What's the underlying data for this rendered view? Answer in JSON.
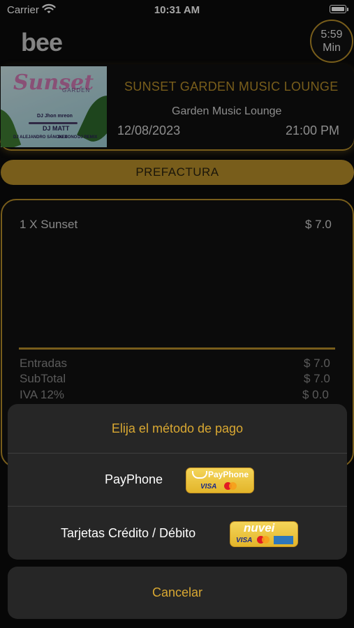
{
  "status_bar": {
    "carrier": "Carrier",
    "time": "10:31 AM"
  },
  "header": {
    "logo": "bee",
    "timer_value": "5:59",
    "timer_unit": "Min"
  },
  "event": {
    "flyer_title": "Sunset",
    "flyer_subtitle": "GARDEN",
    "flyer_djs": [
      "DJ Jhon mreon",
      "DJ MATT",
      "DJ ALEJANDRO SÁNCHEZ",
      "DJ NONO",
      "DJ REMIX"
    ],
    "title": "SUNSET GARDEN MUSIC LOUNGE",
    "venue": "Garden Music Lounge",
    "date": "12/08/2023",
    "time": "21:00 PM"
  },
  "prefactura": {
    "label": "PREFACTURA"
  },
  "invoice": {
    "items": [
      {
        "description": "1 X Sunset",
        "price": "$ 7.0"
      }
    ],
    "totals": [
      {
        "label": "Entradas",
        "value": "$  7.0"
      },
      {
        "label": "SubTotal",
        "value": "$  7.0"
      },
      {
        "label": "IVA 12%",
        "value": "$  0.0"
      }
    ]
  },
  "action_sheet": {
    "title": "Elija el método de pago",
    "options": [
      {
        "label": "PayPhone",
        "badge_text": "PayPhone",
        "badge_visa": "VISA"
      },
      {
        "label": "Tarjetas Crédito / Débito",
        "badge_text": "nuvei",
        "badge_visa": "VISA"
      }
    ],
    "cancel_label": "Cancelar"
  },
  "colors": {
    "accent": "#b9902a",
    "sheet_accent_text": "#d9a832",
    "background": "#0b0b0b"
  }
}
